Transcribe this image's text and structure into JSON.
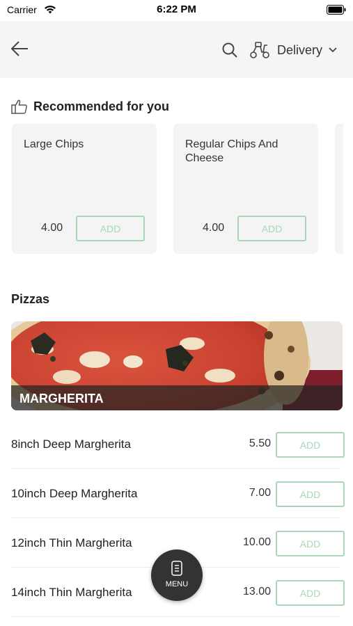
{
  "status_bar": {
    "carrier": "Carrier",
    "time": "6:22 PM"
  },
  "header": {
    "delivery_label": "Delivery"
  },
  "recommended": {
    "title": "Recommended for you",
    "items": [
      {
        "name": "Large Chips",
        "price": "4.00",
        "button": "ADD"
      },
      {
        "name": "Regular Chips And Cheese",
        "price": "4.00",
        "button": "ADD"
      }
    ]
  },
  "section": {
    "title": "Pizzas",
    "banner_label": "MARGHERITA"
  },
  "products": [
    {
      "name": "8inch Deep Margherita",
      "price": "5.50",
      "button": "ADD"
    },
    {
      "name": "10inch Deep Margherita",
      "price": "7.00",
      "button": "ADD"
    },
    {
      "name": "12inch Thin Margherita",
      "price": "10.00",
      "button": "ADD"
    },
    {
      "name": "14inch Thin Margherita",
      "price": "13.00",
      "button": "ADD"
    }
  ],
  "fab": {
    "label": "MENU"
  },
  "colors": {
    "accent": "#a9d6b6",
    "header_bg": "#f5f5f5",
    "fab_bg": "#333333"
  }
}
